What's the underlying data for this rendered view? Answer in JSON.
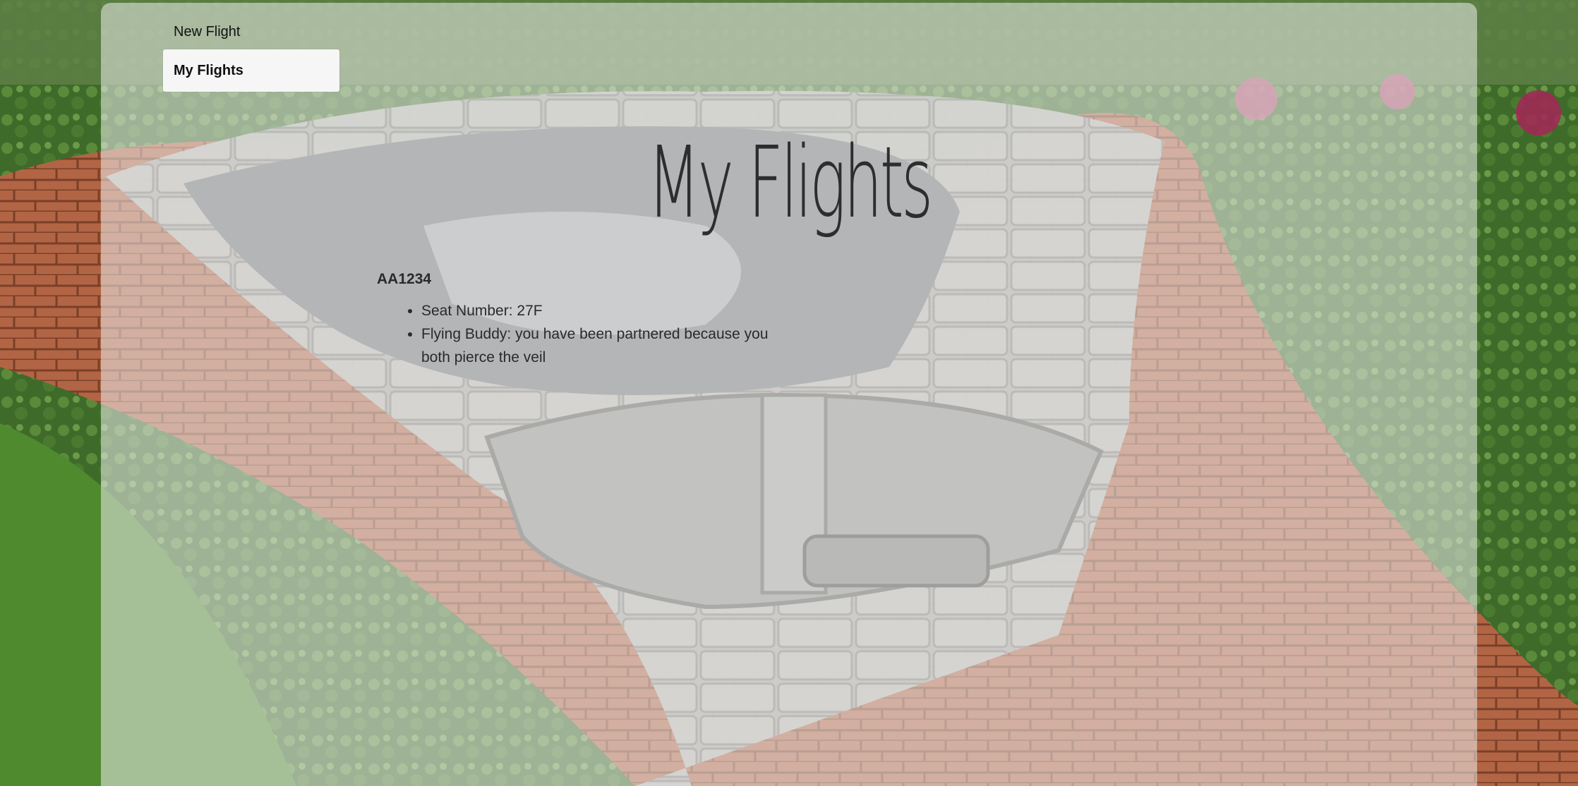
{
  "nav": {
    "items": [
      {
        "label": "New Flight",
        "active": false
      },
      {
        "label": "My Flights",
        "active": true
      }
    ]
  },
  "page": {
    "title": "My Flights"
  },
  "flights": [
    {
      "code": "AA1234",
      "details": [
        "Seat Number: 27F",
        "Flying Buddy: you have been partnered because you both pierce the veil"
      ]
    }
  ],
  "colors": {
    "panel_overlay": "#ececec",
    "active_nav_background": "#f6f6f6",
    "text": "#222222",
    "brick_path": "#b0613f",
    "grass": "#4f7a32",
    "stone": "#9d9d9a",
    "water": "#6f7378"
  },
  "background": {
    "description_icon": "garden-zipper-photo"
  }
}
